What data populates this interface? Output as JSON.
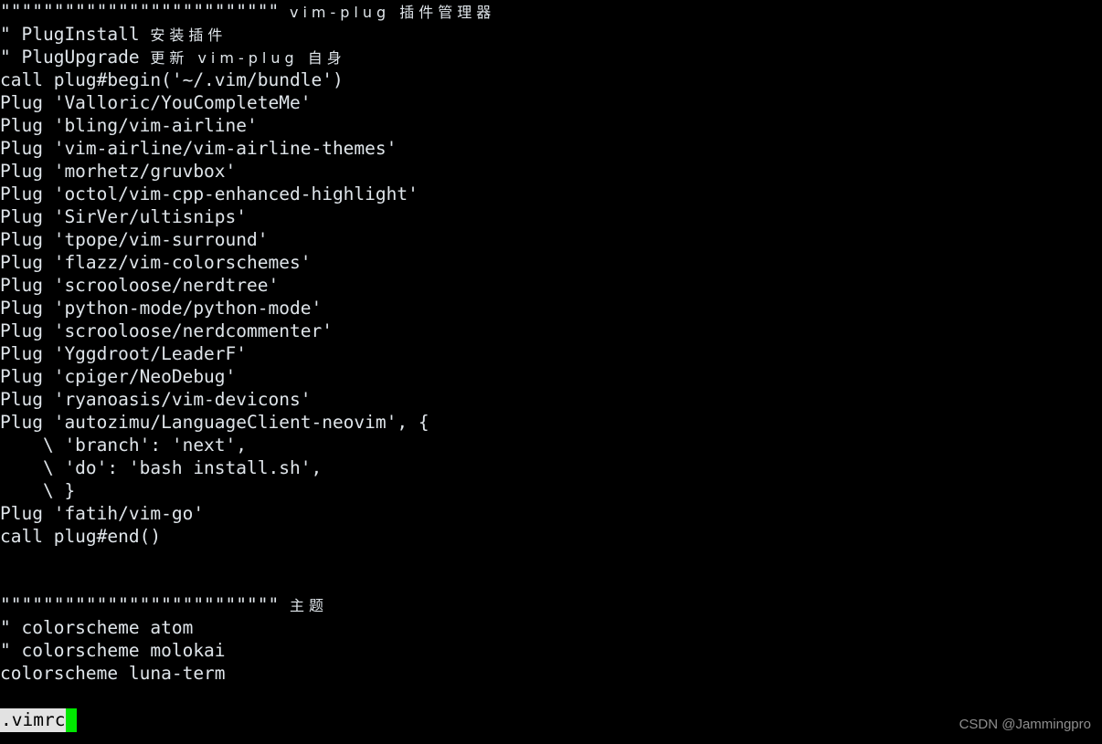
{
  "window": {
    "app": "vim",
    "background_color": "#000000",
    "foreground_color": "#dfe5ea"
  },
  "editor": {
    "lines": [
      {
        "ascii": "\"\"\"\"\"\"\"\"\"\"\"\"\"\"\"\"\"\"\"\"\"\"\"\"\"\" ",
        "cjk": "vim-plug 插件管理器",
        "cjk_prefix": ""
      },
      {
        "ascii": "\" PlugInstall ",
        "cjk": "安装插件"
      },
      {
        "ascii": "\" PlugUpgrade ",
        "cjk": "更新 vim-plug 自身"
      },
      {
        "ascii": "call plug#begin('~/.vim/bundle')",
        "cjk": ""
      },
      {
        "ascii": "Plug 'Valloric/YouCompleteMe'",
        "cjk": ""
      },
      {
        "ascii": "Plug 'bling/vim-airline'",
        "cjk": ""
      },
      {
        "ascii": "Plug 'vim-airline/vim-airline-themes'",
        "cjk": ""
      },
      {
        "ascii": "Plug 'morhetz/gruvbox'",
        "cjk": ""
      },
      {
        "ascii": "Plug 'octol/vim-cpp-enhanced-highlight'",
        "cjk": ""
      },
      {
        "ascii": "Plug 'SirVer/ultisnips'",
        "cjk": ""
      },
      {
        "ascii": "Plug 'tpope/vim-surround'",
        "cjk": ""
      },
      {
        "ascii": "Plug 'flazz/vim-colorschemes'",
        "cjk": ""
      },
      {
        "ascii": "Plug 'scrooloose/nerdtree'",
        "cjk": ""
      },
      {
        "ascii": "Plug 'python-mode/python-mode'",
        "cjk": ""
      },
      {
        "ascii": "Plug 'scrooloose/nerdcommenter'",
        "cjk": ""
      },
      {
        "ascii": "Plug 'Yggdroot/LeaderF'",
        "cjk": ""
      },
      {
        "ascii": "Plug 'cpiger/NeoDebug'",
        "cjk": ""
      },
      {
        "ascii": "Plug 'ryanoasis/vim-devicons'",
        "cjk": ""
      },
      {
        "ascii": "Plug 'autozimu/LanguageClient-neovim', {",
        "cjk": ""
      },
      {
        "ascii": "    \\ 'branch': 'next',",
        "cjk": ""
      },
      {
        "ascii": "    \\ 'do': 'bash install.sh',",
        "cjk": ""
      },
      {
        "ascii": "    \\ }",
        "cjk": ""
      },
      {
        "ascii": "Plug 'fatih/vim-go'",
        "cjk": ""
      },
      {
        "ascii": "call plug#end()",
        "cjk": ""
      },
      {
        "ascii": "",
        "cjk": ""
      },
      {
        "ascii": "",
        "cjk": ""
      },
      {
        "ascii": "\"\"\"\"\"\"\"\"\"\"\"\"\"\"\"\"\"\"\"\"\"\"\"\"\"\" ",
        "cjk": "主题"
      },
      {
        "ascii": "\" colorscheme atom",
        "cjk": ""
      },
      {
        "ascii": "\" colorscheme molokai",
        "cjk": ""
      },
      {
        "ascii": "colorscheme luna-term",
        "cjk": ""
      }
    ]
  },
  "statusline": {
    "filename": ".vimrc",
    "cursor_color": "#00e800",
    "background_color": "#e2e2e2",
    "text_color": "#000000"
  },
  "watermark": {
    "text": "CSDN @Jammingpro"
  }
}
